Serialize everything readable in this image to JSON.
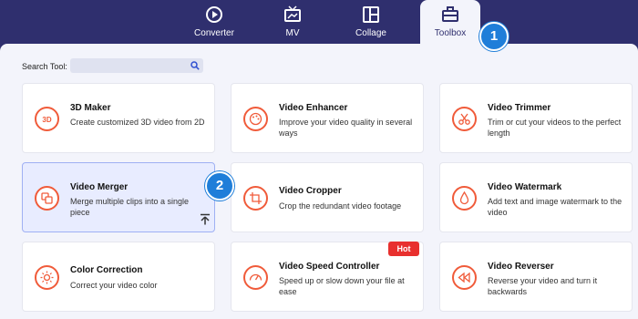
{
  "tabs": [
    {
      "label": "Converter",
      "icon": "converter-icon",
      "active": false
    },
    {
      "label": "MV",
      "icon": "tv-icon",
      "active": false
    },
    {
      "label": "Collage",
      "icon": "collage-icon",
      "active": false
    },
    {
      "label": "Toolbox",
      "icon": "toolbox-icon",
      "active": true
    }
  ],
  "search": {
    "label": "Search Tool:",
    "value": ""
  },
  "tools": [
    {
      "title": "3D Maker",
      "desc": "Create customized 3D video from 2D"
    },
    {
      "title": "Video Enhancer",
      "desc": "Improve your video quality in several ways"
    },
    {
      "title": "Video Trimmer",
      "desc": "Trim or cut your videos to the perfect length"
    },
    {
      "title": "Video Merger",
      "desc": "Merge multiple clips into a single piece"
    },
    {
      "title": "Video Cropper",
      "desc": "Crop the redundant video footage"
    },
    {
      "title": "Video Watermark",
      "desc": "Add text and image watermark to the video"
    },
    {
      "title": "Color Correction",
      "desc": "Correct your video color"
    },
    {
      "title": "Video Speed Controller",
      "desc": "Speed up or slow down your file at ease"
    },
    {
      "title": "Video Reverser",
      "desc": "Reverse your video and turn it backwards"
    }
  ],
  "hot_badge": "Hot",
  "step_markers": [
    "1",
    "2"
  ],
  "colors": {
    "header_bg": "#2f2f6e",
    "accent": "#f05b3a",
    "marker": "#1f7ed9",
    "hot": "#e8302e",
    "selected_bg": "#e8ecff"
  }
}
